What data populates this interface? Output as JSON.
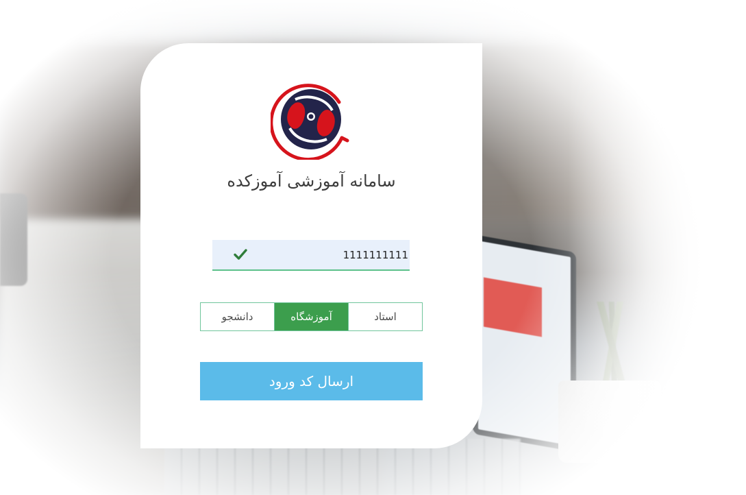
{
  "app": {
    "title": "سامانه آموزشی آموزکده",
    "logo_icon": "amoozkadeh-logo-icon"
  },
  "login": {
    "mobile_value": "1111111111",
    "mobile_valid_icon": "check-icon",
    "roles": [
      {
        "label": "استاد",
        "active": false
      },
      {
        "label": "آموزشگاه",
        "active": true
      },
      {
        "label": "دانشجو",
        "active": false
      }
    ],
    "submit_label": "ارسال کد ورود"
  },
  "colors": {
    "accent_green": "#3c9e4d",
    "field_border": "#5cc18a",
    "button_blue": "#5bbbe9",
    "logo_red": "#d6141c",
    "logo_navy": "#23244a"
  }
}
